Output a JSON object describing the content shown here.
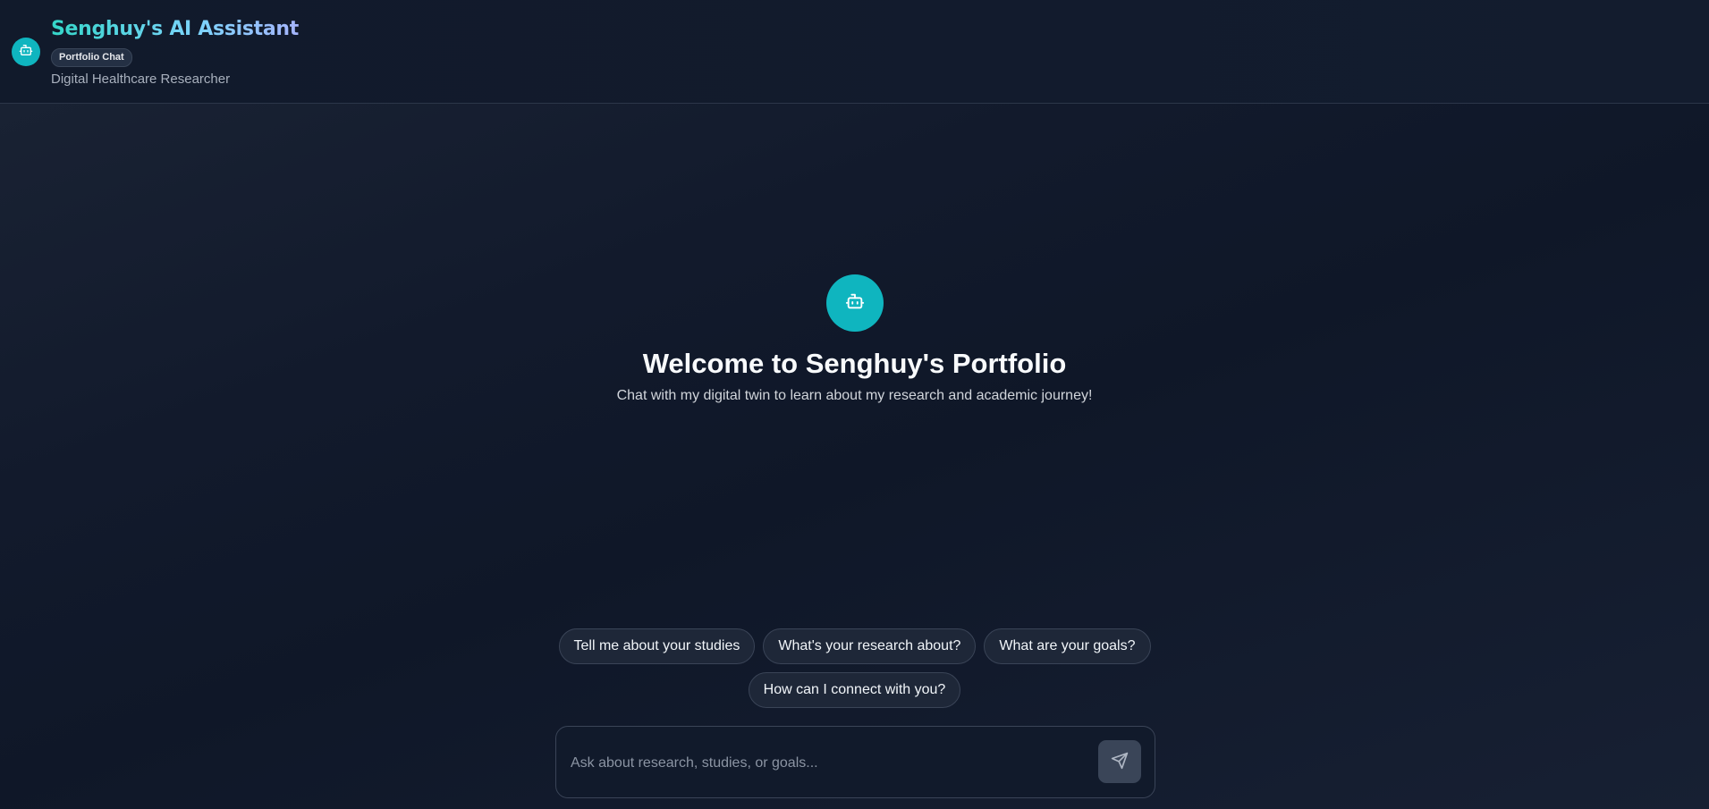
{
  "header": {
    "title": "Senghuy's AI Assistant",
    "badge": "Portfolio Chat",
    "subtitle": "Digital Healthcare Researcher",
    "avatar_icon": "robot-icon"
  },
  "welcome": {
    "avatar_icon": "robot-icon",
    "title": "Welcome to Senghuy's Portfolio",
    "subtitle": "Chat with my digital twin to learn about my research and academic journey!"
  },
  "suggestions": [
    {
      "label": "Tell me about your studies"
    },
    {
      "label": "What's your research about?"
    },
    {
      "label": "What are your goals?"
    },
    {
      "label": "How can I connect with you?"
    }
  ],
  "input": {
    "placeholder": "Ask about research, studies, or goals...",
    "value": "",
    "send_icon": "send-icon"
  },
  "colors": {
    "accent": "#0fb5bf",
    "background": "#121a2c",
    "send_button": "#3a4558"
  }
}
